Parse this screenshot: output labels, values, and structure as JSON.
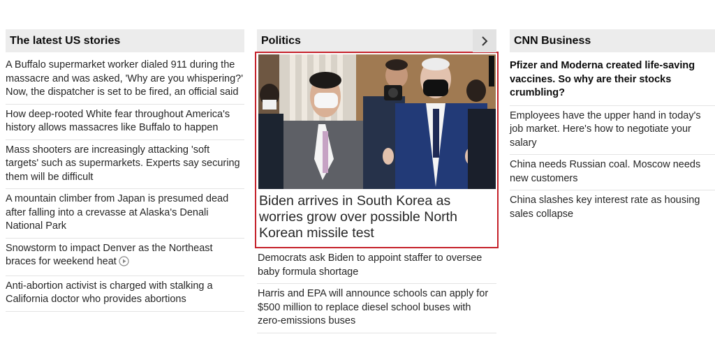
{
  "latest_us": {
    "title": "The latest US stories",
    "items": [
      "A Buffalo supermarket worker dialed 911 during the massacre and was asked, 'Why are you whispering?' Now, the dispatcher is set to be fired, an official said",
      "How deep-rooted White fear throughout America's history allows massacres like Buffalo to happen",
      "Mass shooters are increasingly attacking 'soft targets' such as supermarkets. Experts say securing them will be difficult",
      "A mountain climber from Japan is presumed dead after falling into a crevasse at Alaska's Denali National Park",
      "Snowstorm to impact Denver as the Northeast braces for weekend heat",
      "Anti-abortion activist is charged with stalking a California doctor who provides abortions"
    ]
  },
  "politics": {
    "title": "Politics",
    "feature_headline": "Biden arrives in South Korea as worries grow over possible North Korean missile test",
    "items": [
      "Democrats ask Biden to appoint staffer to oversee baby formula shortage",
      "Harris and EPA will announce schools can apply for $500 million to replace diesel school buses with zero-emissions buses"
    ]
  },
  "business": {
    "title": "CNN Business",
    "lead": "Pfizer and Moderna created life-saving vaccines. So why are their stocks crumbling?",
    "items": [
      "Employees have the upper hand in today's job market. Here's how to negotiate your salary",
      "China needs Russian coal. Moscow needs new customers",
      "China slashes key interest rate as housing sales collapse"
    ]
  },
  "icons": {
    "video": "play-circle-icon",
    "next": "chevron-right-icon"
  },
  "colors": {
    "highlight_border": "#c5212a",
    "header_bg": "#ececec"
  }
}
